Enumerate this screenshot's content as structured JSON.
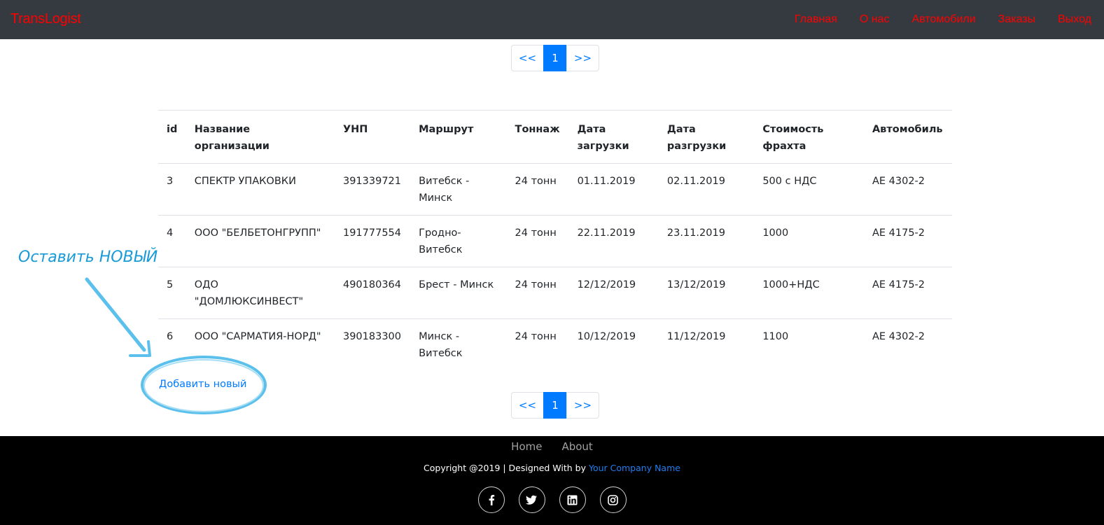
{
  "navbar": {
    "brand": "TransLogist",
    "links": [
      "Главная",
      "О нас",
      "Автомобили",
      "Заказы",
      "Выход"
    ]
  },
  "pagination": {
    "prev": "<<",
    "current": "1",
    "next": ">>"
  },
  "table": {
    "headers": {
      "id": "id",
      "name": "Название организации",
      "unp": "УНП",
      "route": "Маршрут",
      "tonnage": "Тоннаж",
      "load_date": "Дата загрузки",
      "unload_date": "Дата разгрузки",
      "price": "Стоимость фрахта",
      "car": "Автомобиль"
    },
    "rows": [
      {
        "id": "3",
        "name": "СПЕКТР УПАКОВКИ",
        "unp": "391339721",
        "route": "Витебск - Минск",
        "tonnage": "24 тонн",
        "load_date": "01.11.2019",
        "unload_date": "02.11.2019",
        "price": "500 с НДС",
        "car": "АЕ 4302-2"
      },
      {
        "id": "4",
        "name": "ООО \"БЕЛБЕТОНГРУПП\"",
        "unp": "191777554",
        "route": "Гродно-Витебск",
        "tonnage": "24 тонн",
        "load_date": "22.11.2019",
        "unload_date": "23.11.2019",
        "price": "1000",
        "car": "АЕ 4175-2"
      },
      {
        "id": "5",
        "name": "ОДО \"ДОМЛЮКСИНВЕСТ\"",
        "unp": "490180364",
        "route": "Брест - Минск",
        "tonnage": "24 тонн",
        "load_date": "12/12/2019",
        "unload_date": "13/12/2019",
        "price": "1000+НДС",
        "car": "АЕ 4175-2"
      },
      {
        "id": "6",
        "name": "ООО \"САРМАТИЯ-НОРД\"",
        "unp": "390183300",
        "route": "Минск - Витебск",
        "tonnage": "24 тонн",
        "load_date": "10/12/2019",
        "unload_date": "11/12/2019",
        "price": "1100",
        "car": "АЕ 4302-2"
      }
    ]
  },
  "add_link": "Добавить новый",
  "annotation": "Оставить НОВЫЙ",
  "footer": {
    "links": [
      "Home",
      "About"
    ],
    "copyright_prefix": "Copyright @2019 | Designed With by ",
    "company": "Your Company Name",
    "socials": [
      "facebook-icon",
      "twitter-icon",
      "linkedin-icon",
      "instagram-icon"
    ]
  },
  "colors": {
    "navbar_bg": "#343a40",
    "nav_link": "#ff0000",
    "primary": "#007bff",
    "annotation": "#1a9bd7",
    "footer_bg": "#000000"
  }
}
